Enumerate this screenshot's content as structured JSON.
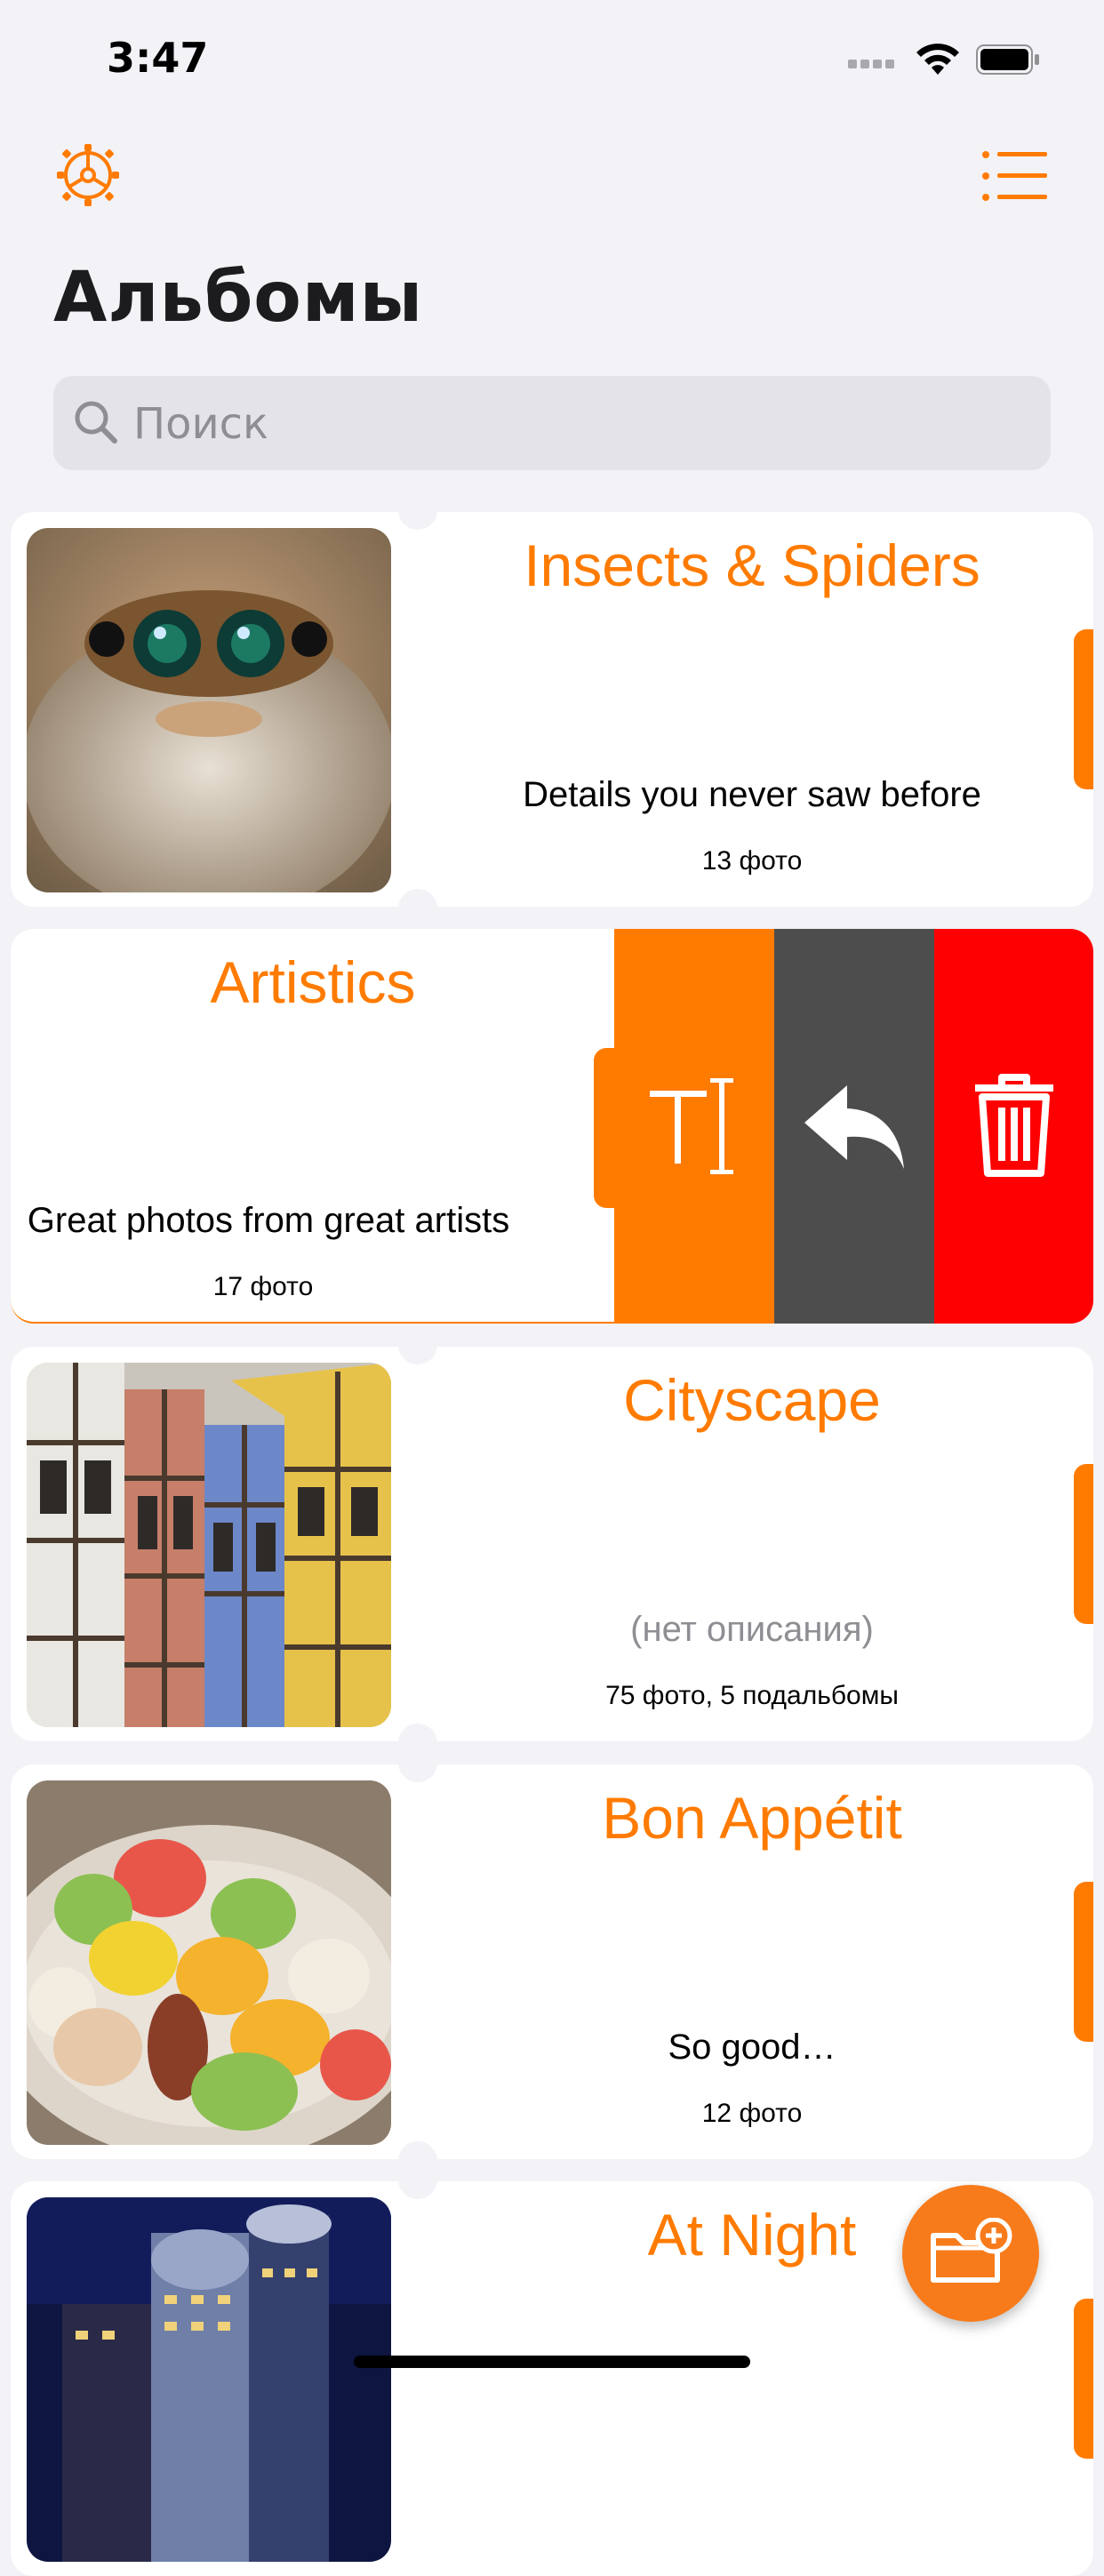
{
  "status_bar": {
    "time": "3:47"
  },
  "header": {
    "settings_icon": "gear-icon",
    "view_icon": "list-icon",
    "title": "Альбомы"
  },
  "search": {
    "placeholder": "Поиск"
  },
  "albums": [
    {
      "name": "Insects & Spiders",
      "description": "Details you never saw before",
      "count": "13 фото"
    },
    {
      "name": "Artistics",
      "description": "Great photos from great artists",
      "count": "17 фото"
    },
    {
      "name": "Cityscape",
      "description": "(нет описания)",
      "count": "75 фото, 5 подальбомы"
    },
    {
      "name": "Bon Appétit",
      "description": "So good…",
      "count": "12 фото"
    },
    {
      "name": "At Night",
      "description": "",
      "count": ""
    }
  ],
  "swipe_actions": {
    "rename_icon": "rename-text-icon",
    "move_icon": "move-reply-icon",
    "delete_icon": "trash-icon"
  },
  "fab_icon": "add-folder-icon",
  "colors": {
    "accent": "#ff7b00",
    "move": "#4d4d4d",
    "delete": "#ff0000",
    "background": "#f2f2f7"
  }
}
